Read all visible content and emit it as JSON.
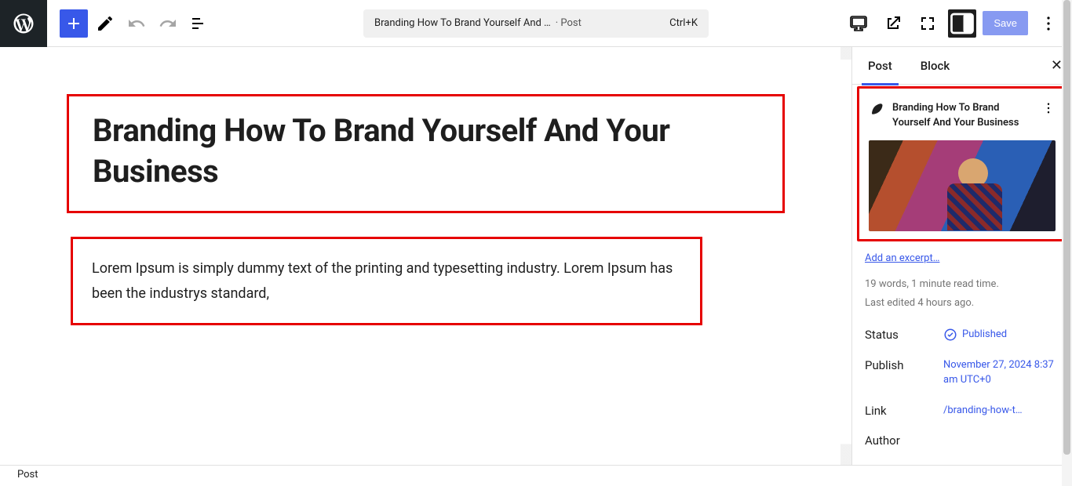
{
  "toolbar": {
    "add_label": "Add block",
    "title_display": "Branding How To Brand Yourself And …",
    "post_type_suffix": "· Post",
    "shortcut": "Ctrl+K",
    "save_label": "Save"
  },
  "sidebar": {
    "tabs": {
      "post": "Post",
      "block": "Block"
    },
    "post_title": "Branding How To Brand Yourself And Your Business",
    "excerpt_link": "Add an excerpt…",
    "meta_words": "19 words, 1 minute read time.",
    "meta_edited": "Last edited 4 hours ago.",
    "fields": {
      "status": {
        "label": "Status",
        "value": "Published"
      },
      "publish": {
        "label": "Publish",
        "value": "November 27, 2024 8:37 am UTC+0"
      },
      "link": {
        "label": "Link",
        "value": "/branding-how-t…"
      },
      "author": {
        "label": "Author",
        "value": ""
      }
    }
  },
  "editor": {
    "title": "Branding How To Brand Yourself And Your Business",
    "paragraph": "Lorem Ipsum is simply dummy text of the printing and typesetting industry. Lorem Ipsum has been the industrys standard,"
  },
  "breadcrumb": "Post"
}
